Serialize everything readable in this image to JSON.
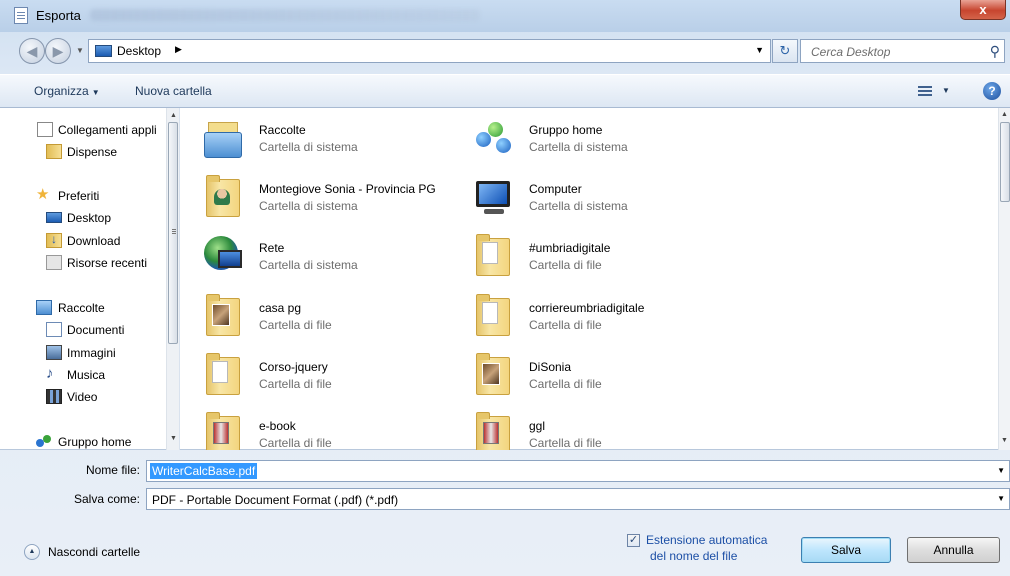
{
  "window": {
    "title": "Esporta",
    "close_label": "x"
  },
  "address": {
    "location": "Desktop",
    "search_placeholder": "Cerca Desktop"
  },
  "toolbar": {
    "organize": "Organizza",
    "new_folder": "Nuova cartella"
  },
  "sidebar": {
    "items": [
      {
        "label": "Collegamenti appli",
        "icon": "document-icon"
      },
      {
        "label": "Dispense",
        "icon": "folder-icon"
      },
      {
        "label": "Preferiti",
        "icon": "star-icon"
      },
      {
        "label": "Desktop",
        "icon": "desktop-icon"
      },
      {
        "label": "Download",
        "icon": "download-icon"
      },
      {
        "label": "Risorse recenti",
        "icon": "recent-places-icon"
      },
      {
        "label": "Raccolte",
        "icon": "library-icon"
      },
      {
        "label": "Documenti",
        "icon": "documents-icon"
      },
      {
        "label": "Immagini",
        "icon": "pictures-icon"
      },
      {
        "label": "Musica",
        "icon": "music-icon"
      },
      {
        "label": "Video",
        "icon": "video-icon"
      },
      {
        "label": "Gruppo home",
        "icon": "homegroup-icon"
      }
    ]
  },
  "files": [
    {
      "name": "Raccolte",
      "type": "Cartella di sistema",
      "icon": "libraries-icon"
    },
    {
      "name": "Gruppo home",
      "type": "Cartella di sistema",
      "icon": "homegroup-icon"
    },
    {
      "name": "Montegiove  Sonia - Provincia PG",
      "type": "Cartella di sistema",
      "icon": "user-folder-icon"
    },
    {
      "name": "Computer",
      "type": "Cartella di sistema",
      "icon": "computer-icon"
    },
    {
      "name": "Rete",
      "type": "Cartella di sistema",
      "icon": "network-icon"
    },
    {
      "name": "#umbriadigitale",
      "type": "Cartella di file",
      "icon": "folder-icon"
    },
    {
      "name": "casa pg",
      "type": "Cartella di file",
      "icon": "folder-icon"
    },
    {
      "name": "corriereumbriadigitale",
      "type": "Cartella di file",
      "icon": "folder-icon"
    },
    {
      "name": "Corso-jquery",
      "type": "Cartella di file",
      "icon": "folder-icon"
    },
    {
      "name": "DiSonia",
      "type": "Cartella di file",
      "icon": "folder-icon"
    },
    {
      "name": "e-book",
      "type": "Cartella di file",
      "icon": "folder-icon"
    },
    {
      "name": "ggl",
      "type": "Cartella di file",
      "icon": "folder-icon"
    }
  ],
  "form": {
    "filename_label": "Nome file:",
    "filename_value": "WriterCalcBase.pdf",
    "savetype_label": "Salva come:",
    "savetype_value": "PDF - Portable Document Format (.pdf) (*.pdf)",
    "hide_folders": "Nascondi cartelle",
    "auto_ext_line1": "Estensione automatica",
    "auto_ext_line2": "del nome del file",
    "auto_ext_checked": true,
    "save": "Salva",
    "cancel": "Annulla"
  }
}
